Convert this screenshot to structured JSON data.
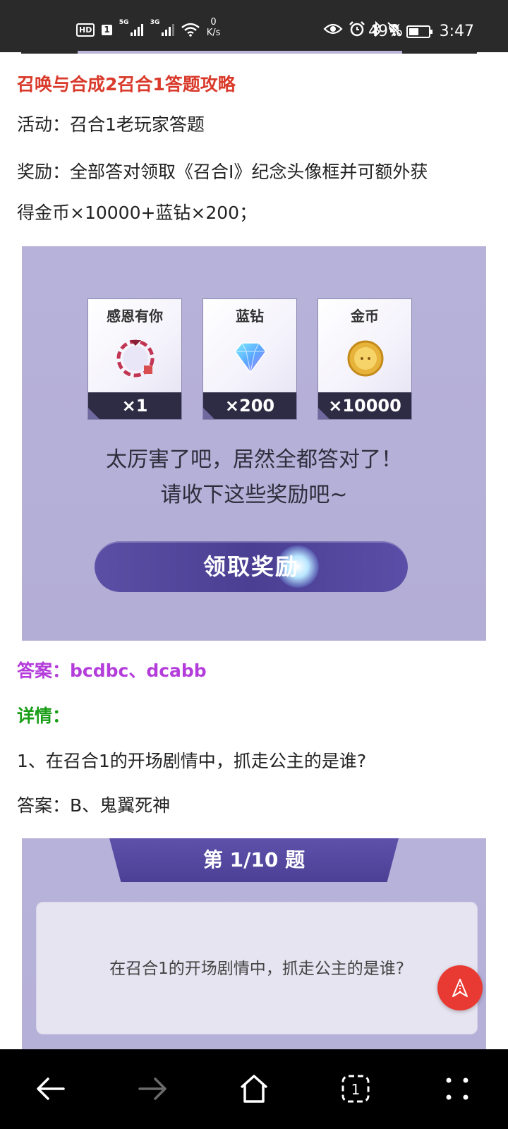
{
  "status_bar": {
    "hd": "HD",
    "sim": "1",
    "sig1_tag": "5G",
    "sig2_tag": "3G",
    "net_speed_value": "0",
    "net_speed_unit": "K/s",
    "battery": "49%",
    "battery_level": 0.49,
    "time": "3:47"
  },
  "article": {
    "title": "召唤与合成2召合1答题攻略",
    "activity": "活动：召合1老玩家答题",
    "reward_line1": "奖励：全部答对领取《召合I》纪念头像框并可额外获",
    "reward_line2": "得金币×10000+蓝钻×200；",
    "answer": "答案：bcdbc、dcabb",
    "details": "详情：",
    "q1": "1、在召合1的开场剧情中，抓走公主的是谁?",
    "q1_answer": "答案：B、鬼翼死神"
  },
  "reward_image": {
    "cards": [
      {
        "title": "感恩有你",
        "count": "×1"
      },
      {
        "title": "蓝钻",
        "count": "×200"
      },
      {
        "title": "金币",
        "count": "×10000"
      }
    ],
    "msg_line1": "太厉害了吧，居然全都答对了！",
    "msg_line2": "请收下这些奖励吧~",
    "button": "领取奖励"
  },
  "question_image": {
    "banner": "第 1/10 题",
    "question": "在召合1的开场剧情中，抓走公主的是谁?"
  },
  "colors": {
    "title": "#d93a2b",
    "answer": "#b33cdb",
    "details": "#1a9e18",
    "fab": "#e83a32"
  }
}
